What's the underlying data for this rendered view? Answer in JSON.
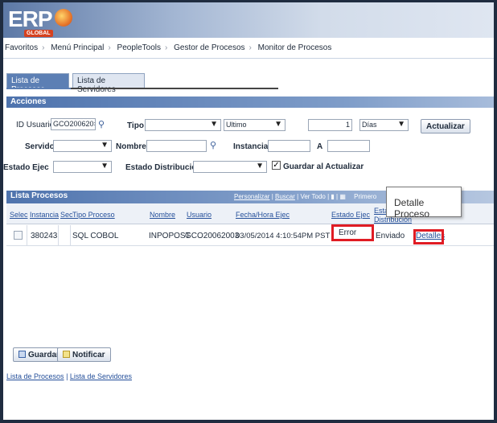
{
  "logo": {
    "main": "ERP",
    "sub": "GLOBAL"
  },
  "nav": [
    "Favoritos",
    "Menú Principal",
    "PeopleTools",
    "Gestor de Procesos",
    "Monitor de Procesos"
  ],
  "tabs": [
    "Lista de Procesos",
    "Lista de Servidores"
  ],
  "acciones": {
    "title": "Acciones",
    "id_usuario_label": "ID Usuario",
    "id_usuario_value": "GCO200620",
    "tipo_label": "Tipo",
    "ultimo_value": "Ultimo",
    "cantidad_value": "1",
    "dias_value": "Días",
    "actualizar": "Actualizar",
    "servidor_label": "Servidor",
    "nombre_label": "Nombre",
    "instancia_label": "Instancia",
    "a_label": "A",
    "estado_ejec_label": "Estado Ejec",
    "estado_dist_label": "Estado Distribución",
    "guardar_label": "Guardar al Actualizar"
  },
  "grid": {
    "title": "Lista Procesos",
    "links": {
      "personalizar": "Personalizar",
      "buscar": "Buscar",
      "ver_todo": "Ver Todo",
      "primero": "Primero"
    },
    "headers": {
      "selec": "Selec",
      "instancia": "Instancia",
      "sec": "Sec",
      "tipo_proceso": "Tipo Proceso",
      "nombre": "Nombre",
      "usuario": "Usuario",
      "fecha": "Fecha/Hora Ejec",
      "estado_ejec": "Estado Ejec",
      "estado_dist_1": "Esta",
      "estado_dist_2": "Distribución"
    },
    "row": {
      "instancia": "380243",
      "tipo": "SQL COBOL",
      "nombre": "INPOPOST",
      "usuario": "GCO20062003",
      "fecha": "03/05/2014  4:10:54PM PST",
      "estado": "Error",
      "distribucion": "Enviado",
      "detalles": "Detalles"
    }
  },
  "tooltip": "Detalle Proceso",
  "buttons": {
    "guardar": "Guardar",
    "notificar": "Notificar"
  },
  "footer": {
    "procesos": "Lista de Procesos",
    "separator": "|",
    "servidores": "Lista de Servidores"
  }
}
